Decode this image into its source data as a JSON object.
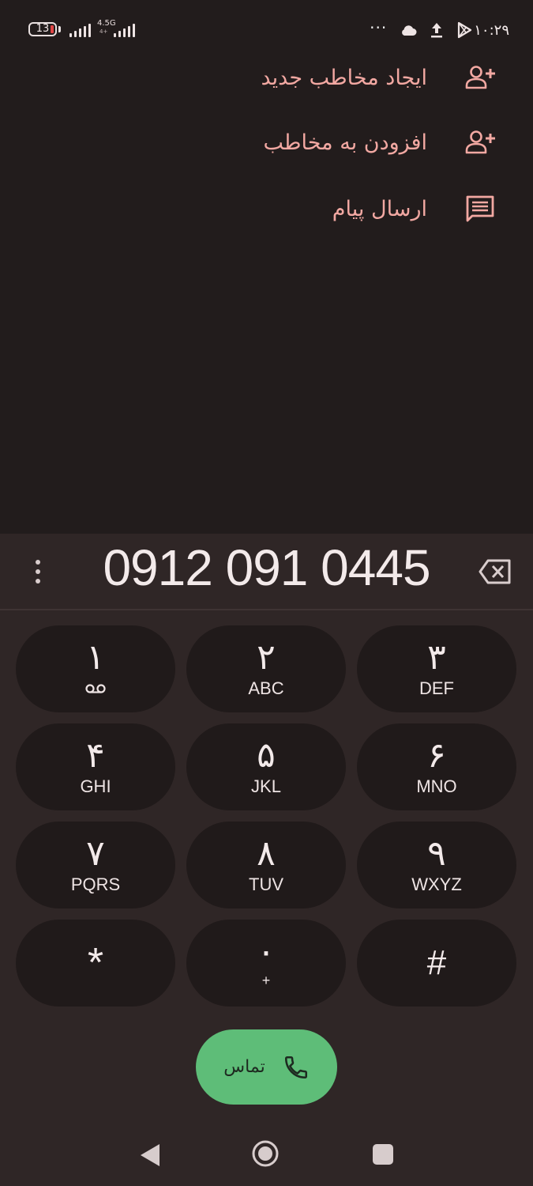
{
  "status_bar": {
    "battery_level": "13",
    "network_type": "4.5G",
    "network_sub": "4+",
    "time": "۱۰:۲۹",
    "icons": [
      "more-dots-icon",
      "cloud-icon",
      "upload-icon",
      "play-store-icon"
    ]
  },
  "suggestions": [
    {
      "label": "ایجاد مخاطب جدید",
      "icon": "person-add-icon"
    },
    {
      "label": "افزودن به مخاطب",
      "icon": "person-add-icon"
    },
    {
      "label": "ارسال پیام",
      "icon": "message-icon"
    }
  ],
  "dialer": {
    "number": "0912 091 0445",
    "keys": [
      {
        "digit": "۱",
        "letters": "",
        "voicemail": true
      },
      {
        "digit": "۲",
        "letters": "ABC"
      },
      {
        "digit": "۳",
        "letters": "DEF"
      },
      {
        "digit": "۴",
        "letters": "GHI"
      },
      {
        "digit": "۵",
        "letters": "JKL"
      },
      {
        "digit": "۶",
        "letters": "MNO"
      },
      {
        "digit": "۷",
        "letters": "PQRS"
      },
      {
        "digit": "۸",
        "letters": "TUV"
      },
      {
        "digit": "۹",
        "letters": "WXYZ"
      },
      {
        "digit": "*",
        "letters": ""
      },
      {
        "digit": "۰",
        "letters": "+"
      },
      {
        "digit": "#",
        "letters": ""
      }
    ],
    "call_label": "تماس"
  },
  "colors": {
    "background": "#221c1c",
    "panel": "#2f2626",
    "accent_text": "#f2a8a2",
    "call_green": "#5ebd78"
  }
}
